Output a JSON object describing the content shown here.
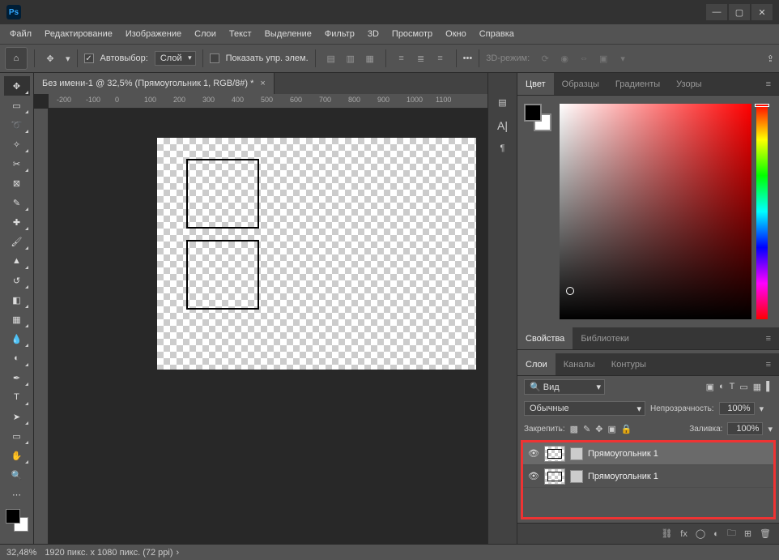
{
  "app": {
    "logo_text": "Ps"
  },
  "menu": [
    "Файл",
    "Редактирование",
    "Изображение",
    "Слои",
    "Текст",
    "Выделение",
    "Фильтр",
    "3D",
    "Просмотр",
    "Окно",
    "Справка"
  ],
  "options": {
    "autoselect_label": "Автовыбор:",
    "autoselect_mode": "Слой",
    "show_transform_label": "Показать упр. элем.",
    "mode_3d": "3D-режим:"
  },
  "document": {
    "tab_title": "Без имени-1 @ 32,5% (Прямоугольник 1, RGB/8#) *",
    "ruler_ticks": [
      "-200",
      "-100",
      "0",
      "100",
      "200",
      "300",
      "400",
      "500",
      "600",
      "700",
      "800",
      "900",
      "1000",
      "1100"
    ]
  },
  "color_tabs": [
    "Цвет",
    "Образцы",
    "Градиенты",
    "Узоры"
  ],
  "props_tabs": [
    "Свойства",
    "Библиотеки"
  ],
  "layers_tabs": [
    "Слои",
    "Каналы",
    "Контуры"
  ],
  "layers_panel": {
    "kind_label": "Вид",
    "blend_mode": "Обычные",
    "opacity_label": "Непрозрачность:",
    "opacity_value": "100%",
    "lock_label": "Закрепить:",
    "fill_label": "Заливка:",
    "fill_value": "100%",
    "layers": [
      {
        "name": "Прямоугольник 1"
      },
      {
        "name": "Прямоугольник 1"
      }
    ]
  },
  "status": {
    "zoom": "32,48%",
    "doc_info": "1920 пикс. x 1080 пикс. (72 ppi)"
  }
}
